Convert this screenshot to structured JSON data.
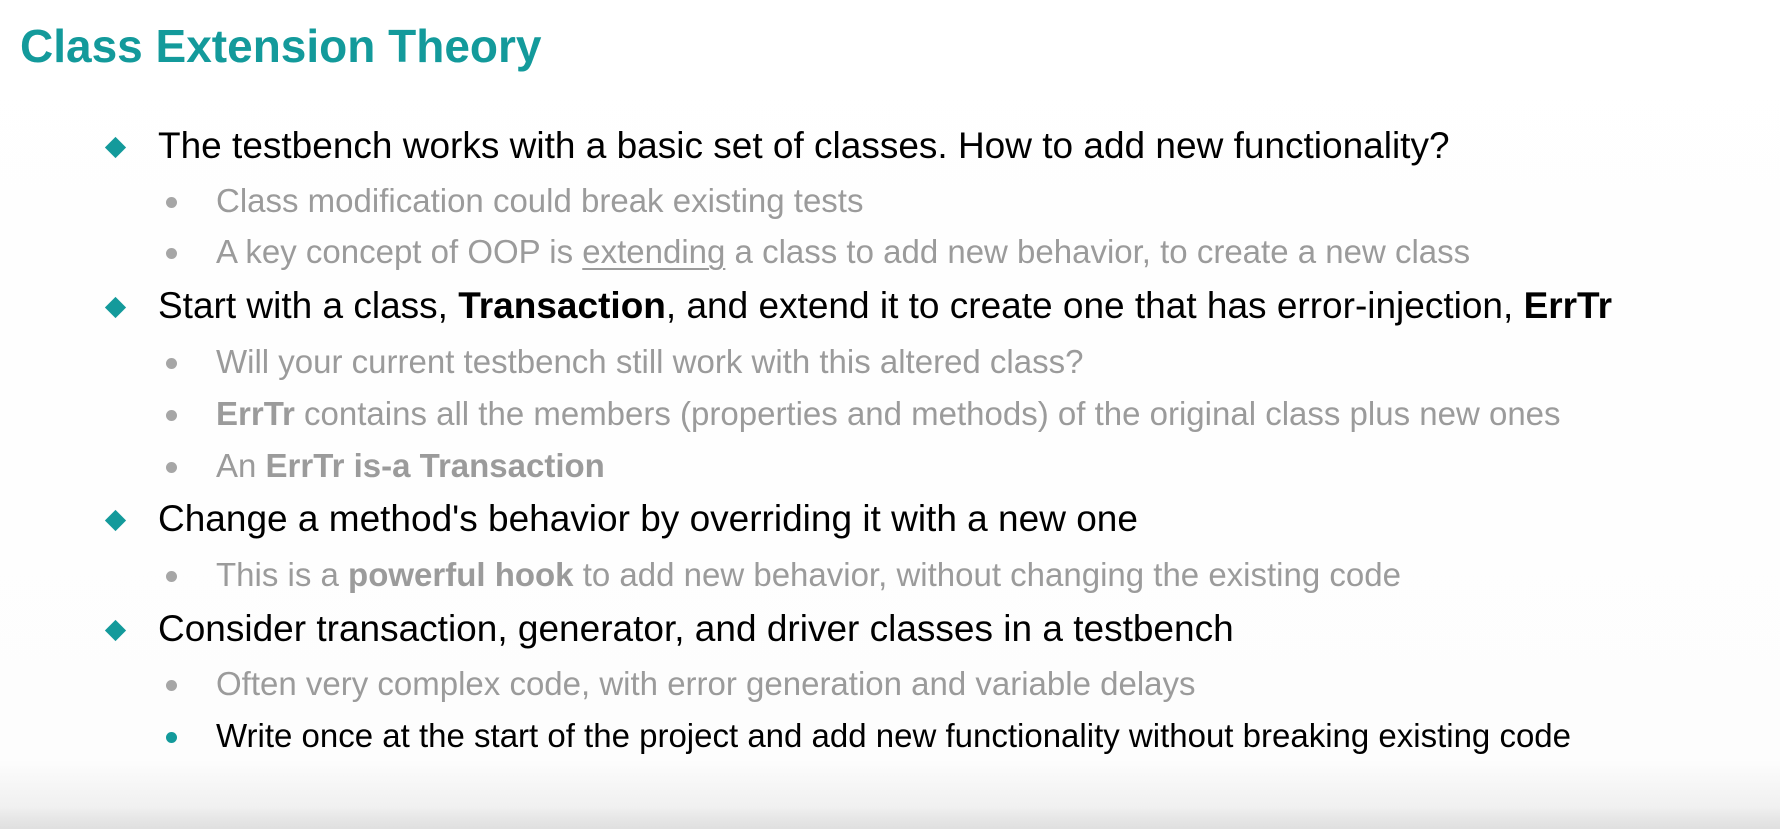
{
  "slide": {
    "title": "Class Extension Theory"
  },
  "colors": {
    "accent": "#139A9B",
    "primary_text": "#000000",
    "secondary_text": "#9B9B9B",
    "dot_gray": "#A6A6A6"
  },
  "icons": {
    "level1": "diamond-bullet-icon",
    "level2": "dot-bullet-icon"
  },
  "bullets": {
    "b1": {
      "text": "The testbench works with a basic set of classes. How to add new functionality?",
      "sub1": "Class modification could break existing tests",
      "sub2": {
        "a": "A key concept of OOP is ",
        "b": "extending",
        "c": " a class to add new behavior, to create a new class"
      }
    },
    "b2": {
      "a": "Start with a class, ",
      "b": "Transaction",
      "c": ", and extend it to create one that has error-injection, ",
      "d": "ErrTr",
      "sub1": "Will your current testbench still work with this altered class?",
      "sub2": {
        "a": "ErrTr",
        "b": " contains all the members (properties and methods) of the original class plus new ones"
      },
      "sub3": {
        "a": "An ",
        "b": "ErrTr is-a Transaction"
      }
    },
    "b3": {
      "text": "Change a method's behavior by overriding it with a new one",
      "sub1": {
        "a": "This is a ",
        "b": "powerful hook",
        "c": " to add new behavior, without changing the existing code"
      }
    },
    "b4": {
      "text": "Consider transaction, generator, and driver classes in a testbench",
      "sub1": "Often very complex code, with error generation and variable delays",
      "sub2": "Write once at the start of the project and add new functionality without breaking existing code"
    }
  }
}
